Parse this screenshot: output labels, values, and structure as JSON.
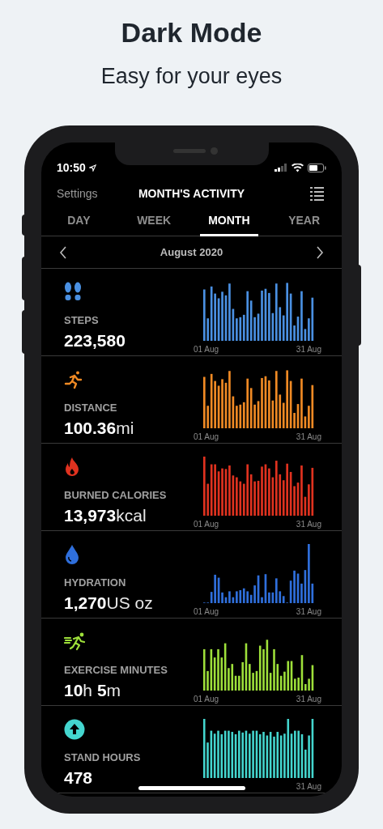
{
  "headline": "Dark Mode",
  "subheadline": "Easy for your eyes",
  "status_bar": {
    "time": "10:50"
  },
  "nav": {
    "back": "Settings",
    "title": "MONTH'S ACTIVITY"
  },
  "tabs": [
    {
      "label": "DAY",
      "selected": false
    },
    {
      "label": "WEEK",
      "selected": false
    },
    {
      "label": "MONTH",
      "selected": true
    },
    {
      "label": "YEAR",
      "selected": false
    }
  ],
  "period": {
    "label": "August 2020"
  },
  "metrics": [
    {
      "kind": "steps",
      "color": "#4a90e2",
      "label": "STEPS",
      "segments": [
        {
          "kind": "number",
          "text": "223,580"
        }
      ],
      "chart_start": "01 Aug",
      "chart_end": "31 Aug"
    },
    {
      "kind": "distance",
      "color": "#f08a24",
      "label": "DISTANCE",
      "segments": [
        {
          "kind": "number",
          "text": "100.36"
        },
        {
          "kind": "unit",
          "text": "mi"
        }
      ],
      "chart_start": "01 Aug",
      "chart_end": "31 Aug"
    },
    {
      "kind": "calories",
      "color": "#e0321f",
      "label": "BURNED CALORIES",
      "segments": [
        {
          "kind": "number",
          "text": "13,973"
        },
        {
          "kind": "unit",
          "text": "kcal"
        }
      ],
      "chart_start": "01 Aug",
      "chart_end": "31 Aug"
    },
    {
      "kind": "hydration",
      "color": "#2f6fdc",
      "label": "HYDRATION",
      "segments": [
        {
          "kind": "number",
          "text": "1,270"
        },
        {
          "kind": "unit",
          "text": "US oz"
        }
      ],
      "chart_start": "01 Aug",
      "chart_end": "31 Aug"
    },
    {
      "kind": "exercise",
      "color": "#9ee03a",
      "label": "EXERCISE MINUTES",
      "segments": [
        {
          "kind": "number",
          "text": "10"
        },
        {
          "kind": "unit",
          "text": "h "
        },
        {
          "kind": "number",
          "text": "5"
        },
        {
          "kind": "unit",
          "text": "m"
        }
      ],
      "chart_start": "01 Aug",
      "chart_end": "31 Aug"
    },
    {
      "kind": "stand",
      "color": "#44d6cf",
      "label": "STAND HOURS",
      "segments": [
        {
          "kind": "number",
          "text": "478"
        }
      ],
      "chart_end": "31 Aug"
    }
  ]
}
